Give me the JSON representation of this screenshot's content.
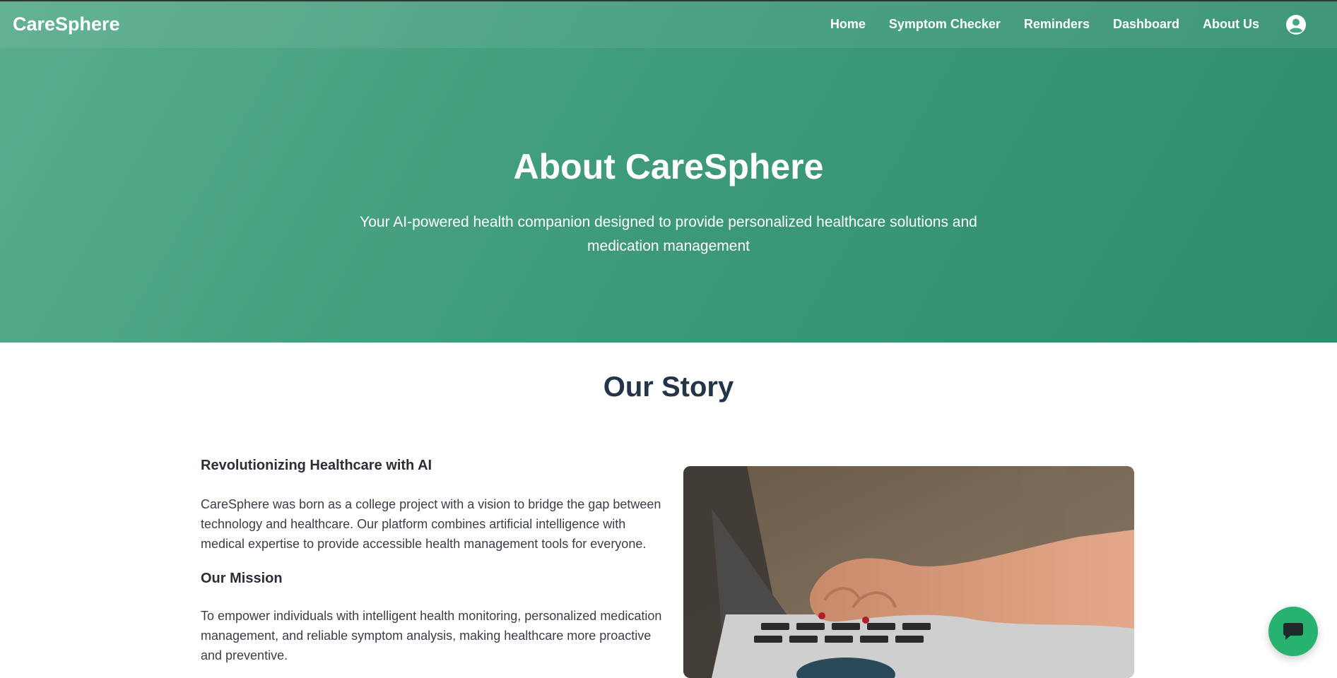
{
  "brand": "CareSphere",
  "nav": {
    "items": [
      "Home",
      "Symptom Checker",
      "Reminders",
      "Dashboard",
      "About Us"
    ],
    "account_icon": "user-circle-icon"
  },
  "hero": {
    "title": "About CareSphere",
    "subtitle": "Your AI-powered health companion designed to provide personalized healthcare solutions and medication management"
  },
  "story": {
    "title": "Our Story",
    "sections": [
      {
        "heading": "Revolutionizing Healthcare with AI",
        "text": "CareSphere was born as a college project with a vision to bridge the gap between technology and healthcare. Our platform combines artificial intelligence with medical expertise to provide accessible health management tools for everyone."
      },
      {
        "heading": "Our Mission",
        "text": "To empower individuals with intelligent health monitoring, personalized medication management, and reliable symptom analysis, making healthcare more proactive and preventive."
      }
    ],
    "image_icon": "laptop-typing-photo"
  },
  "chat": {
    "icon": "chat-bubble-icon"
  },
  "colors": {
    "hero_start": "#58ad8c",
    "hero_end": "#2f8c6c",
    "chat_button": "#27b36f",
    "heading_dark": "#24344a"
  }
}
